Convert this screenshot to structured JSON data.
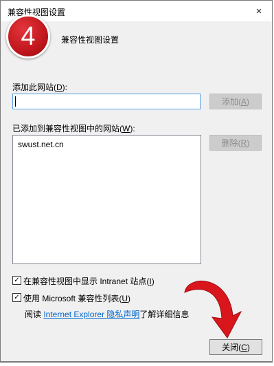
{
  "dialog": {
    "title": "兼容性视图设置",
    "close_icon": "×"
  },
  "badge": {
    "number": "4",
    "color": "#c1161d"
  },
  "top_option": {
    "label": "兼容性视图设置",
    "cursor_mark": "↵"
  },
  "add_section": {
    "label_prefix": "添加此网站(",
    "label_key": "D",
    "label_suffix": "):",
    "input_value": "",
    "add_button_prefix": "添加(",
    "add_button_key": "A",
    "add_button_suffix": ")"
  },
  "list_section": {
    "label_prefix": "已添加到兼容性视图中的网站(",
    "label_key": "W",
    "label_suffix": "):",
    "items": [
      "swust.net.cn"
    ],
    "remove_button_prefix": "删除(",
    "remove_button_key": "R",
    "remove_button_suffix": ")"
  },
  "options": [
    {
      "prefix": "在兼容性视图中显示 Intranet 站点(",
      "key": "I",
      "suffix": ")",
      "checked": true
    },
    {
      "prefix": "使用 Microsoft 兼容性列表(",
      "key": "U",
      "suffix": ")",
      "checked": true
    }
  ],
  "info": {
    "prefix": "阅读 ",
    "link_text": "Internet Explorer 隐私声明",
    "suffix": "了解详细信息"
  },
  "close_button": {
    "prefix": "关闭(",
    "key": "C",
    "suffix": ")"
  },
  "colors": {
    "link": "#0066cc",
    "arrow": "#d9161c",
    "focus_border": "#569de5"
  },
  "icons": {
    "checkbox_mark": "✓"
  }
}
